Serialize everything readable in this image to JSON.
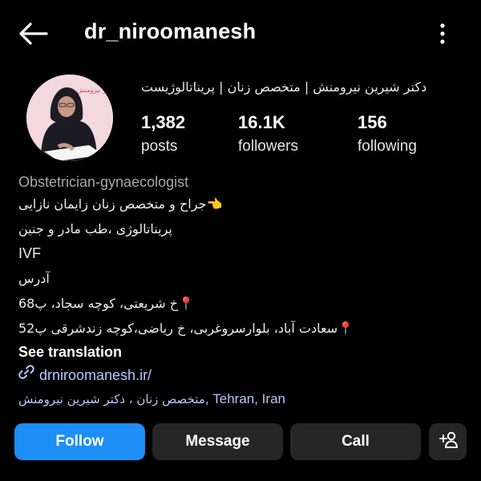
{
  "header": {
    "username": "dr_niroomanesh"
  },
  "profile": {
    "full_name": "دکتر شیرین نیرومنش | متخصص زنان | پریناتالوژیست",
    "avatar_text": "دکتر نیرومنش",
    "stats": [
      {
        "value": "1,382",
        "label": "posts"
      },
      {
        "value": "16.1K",
        "label": "followers"
      },
      {
        "value": "156",
        "label": "following"
      }
    ]
  },
  "bio": {
    "category": "Obstetrician-gynaecologist",
    "lines": [
      "👈جراح و متخصص زنان زایمان نازایی",
      "پریناتالوژی ،طب مادر و جنین",
      "IVF",
      "آدرس",
      "📍خ شریعتی، کوچه سجاد، پ68",
      "📍سعادت آباد، بلوارسروغربی، خ ریاضی،کوچه زندشرقی پ52"
    ],
    "see_translation": "See translation",
    "website": "drniroomanesh.ir/",
    "location_fa": "متخصص زنان ، دکتر شیرین نیرومنش",
    "location_en": ", Tehran, Iran"
  },
  "actions": {
    "follow": "Follow",
    "message": "Message",
    "call": "Call"
  },
  "colors": {
    "background": "#000000",
    "follow_button": "#1e8ff6",
    "secondary_button": "#262626",
    "link": "#b9c7ff"
  }
}
